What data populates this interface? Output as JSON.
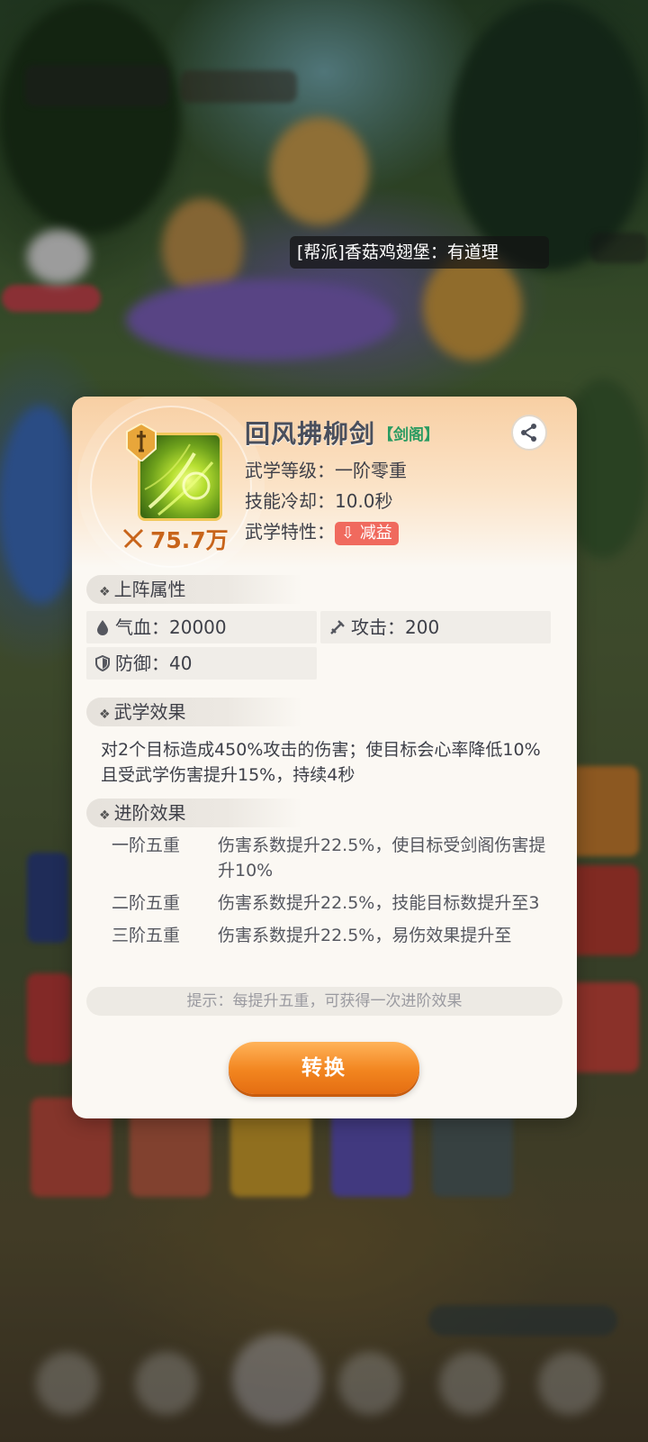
{
  "chat": {
    "message": "[帮派]香菇鸡翅堡：有道理"
  },
  "skill": {
    "name": "回风拂柳剑",
    "school_tag": "【剑阁】",
    "power": "75.7万",
    "level_label": "武学等级：",
    "level_value": "一阶零重",
    "cooldown_label": "技能冷却：",
    "cooldown_value": "10.0秒",
    "trait_label": "武学特性：",
    "trait_value": "减益",
    "trait_color": "#f06a5e",
    "icons": {
      "power": "crossed-swords-icon",
      "share": "share-icon",
      "school_badge": "sword-badge-icon"
    }
  },
  "sections": {
    "battle_attrs_title": "上阵属性",
    "martial_effect_title": "武学效果",
    "advance_effect_title": "进阶效果"
  },
  "stats": {
    "hp_label": "气血：",
    "hp_value": "20000",
    "atk_label": "攻击：",
    "atk_value": "200",
    "def_label": "防御：",
    "def_value": "40"
  },
  "effect": {
    "text": "对2个目标造成450%攻击的伤害；使目标会心率降低10%且受武学伤害提升15%，持续4秒"
  },
  "advances": [
    {
      "level": "一阶五重",
      "desc": "伤害系数提升22.5%，使目标受剑阁伤害提升10%"
    },
    {
      "level": "二阶五重",
      "desc": "伤害系数提升22.5%，技能目标数提升至3"
    },
    {
      "level": "三阶五重",
      "desc": "伤害系数提升22.5%，易伤效果提升至"
    }
  ],
  "hint": "提示：每提升五重，可获得一次进阶效果",
  "convert_button": "转换",
  "accent_color": "#f2851f"
}
